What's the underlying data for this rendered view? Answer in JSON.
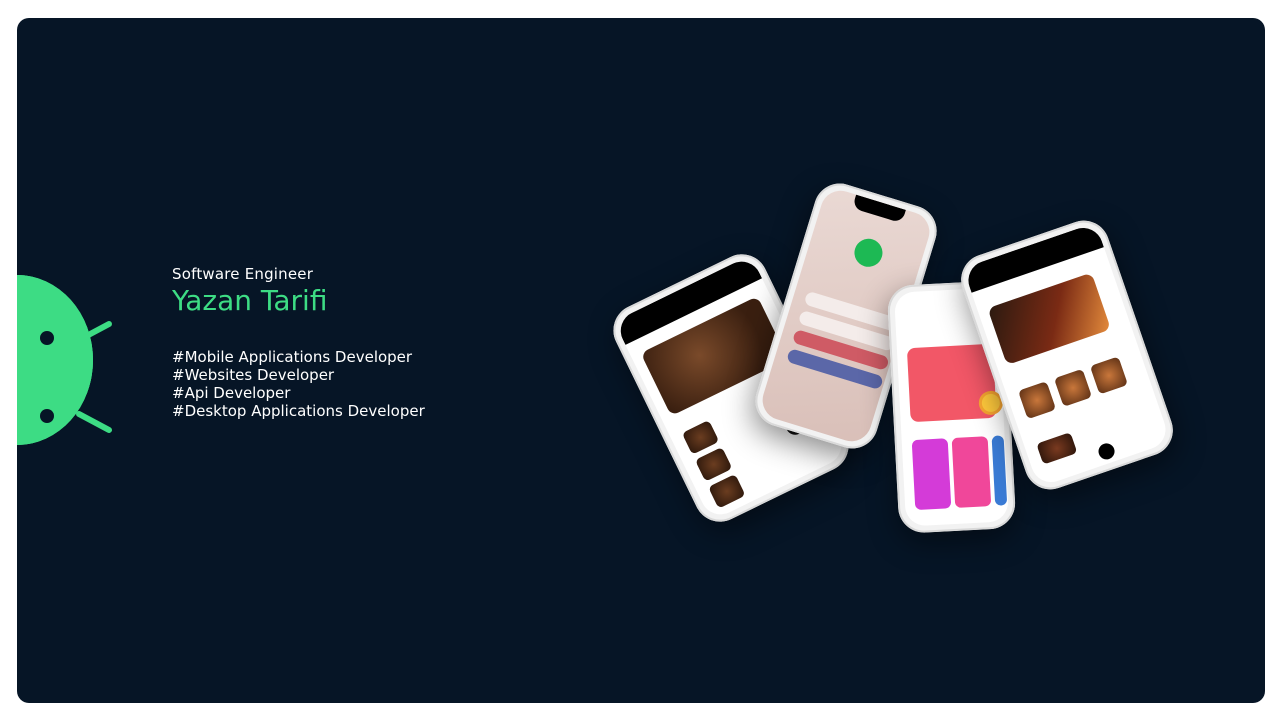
{
  "intro": {
    "role": "Software Engineer",
    "name": "Yazan Tarifi",
    "skills": [
      "#Mobile Applications Developer",
      "#Websites Developer",
      "#Api Developer",
      "#Desktop Applications Developer"
    ]
  },
  "colors": {
    "background": "#061526",
    "accent": "#3ddc84",
    "text": "#ffffff"
  },
  "icons": {
    "logo": "android-logo-icon"
  }
}
